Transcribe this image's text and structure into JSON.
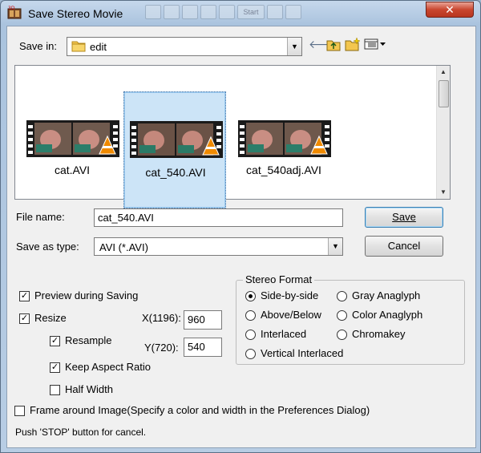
{
  "window": {
    "title": "Save Stereo Movie",
    "close_glyph": "✕",
    "ghost_toolbar": [
      "",
      "",
      "",
      "",
      "",
      "Start",
      "",
      ""
    ]
  },
  "save_in": {
    "label": "Save in:",
    "folder": "edit",
    "icons": [
      "back-arrow-icon",
      "up-folder-icon",
      "new-folder-icon",
      "view-menu-icon"
    ]
  },
  "files": [
    {
      "name": "cat.AVI",
      "selected": false
    },
    {
      "name": "cat_540.AVI",
      "selected": true
    },
    {
      "name": "cat_540adj.AVI",
      "selected": false
    }
  ],
  "file_name": {
    "label": "File name:",
    "value": "cat_540.AVI"
  },
  "save_as_type": {
    "label": "Save as type:",
    "value": "AVI (*.AVI)"
  },
  "buttons": {
    "save": "Save",
    "cancel": "Cancel"
  },
  "options": {
    "preview": {
      "label": "Preview during Saving",
      "checked": true
    },
    "resize": {
      "label": "Resize",
      "checked": true
    },
    "resample": {
      "label": "Resample",
      "checked": true
    },
    "keep_aspect": {
      "label": "Keep Aspect Ratio",
      "checked": true
    },
    "half_width": {
      "label": "Half Width",
      "checked": false
    },
    "x_label": "X(1196):",
    "x_value": "960",
    "y_label": "Y(720):",
    "y_value": "540",
    "frame": {
      "label": "Frame around Image(Specify a color and width in the Preferences Dialog)",
      "checked": false
    }
  },
  "stereo_format": {
    "legend": "Stereo Format",
    "options": [
      {
        "label": "Side-by-side",
        "selected": true
      },
      {
        "label": "Gray Anaglyph",
        "selected": false
      },
      {
        "label": "Above/Below",
        "selected": false
      },
      {
        "label": "Color Anaglyph",
        "selected": false
      },
      {
        "label": "Interlaced",
        "selected": false
      },
      {
        "label": "Chromakey",
        "selected": false
      },
      {
        "label": "Vertical Interlaced",
        "selected": false
      }
    ]
  },
  "status_text": "Push 'STOP' button for cancel."
}
